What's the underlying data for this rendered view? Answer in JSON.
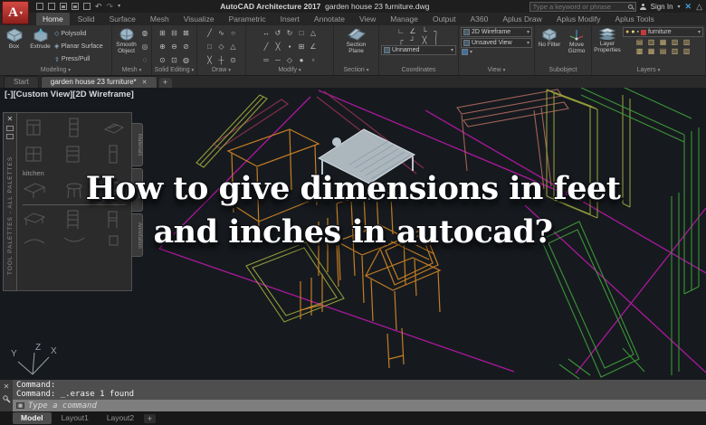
{
  "titlebar": {
    "app_title": "AutoCAD Architecture 2017",
    "doc_title": "garden house 23 furniture.dwg",
    "search_placeholder": "Type a keyword or phrase",
    "sign_in_label": "Sign In"
  },
  "ribbon": {
    "tabs": [
      {
        "label": "Home",
        "active": true
      },
      {
        "label": "Solid"
      },
      {
        "label": "Surface"
      },
      {
        "label": "Mesh"
      },
      {
        "label": "Visualize"
      },
      {
        "label": "Parametric"
      },
      {
        "label": "Insert"
      },
      {
        "label": "Annotate"
      },
      {
        "label": "View"
      },
      {
        "label": "Manage"
      },
      {
        "label": "Output"
      },
      {
        "label": "A360"
      },
      {
        "label": "Aplus Draw"
      },
      {
        "label": "Aplus Modify"
      },
      {
        "label": "Aplus Tools"
      }
    ],
    "panels": {
      "modeling": {
        "label": "Modeling",
        "box": "Box",
        "extrude": "Extrude",
        "polysolid": "Polysolid",
        "planar_surface": "Planar Surface",
        "press_pull": "Press/Pull"
      },
      "mesh": {
        "label": "Mesh",
        "smooth_object": "Smooth Object"
      },
      "solid_editing": {
        "label": "Solid Editing"
      },
      "draw": {
        "label": "Draw"
      },
      "modify": {
        "label": "Modify"
      },
      "section": {
        "label": "Section",
        "section_plane": "Section Plane"
      },
      "coordinates": {
        "label": "Coordinates",
        "named_ucs": "Unnamed"
      },
      "view": {
        "label": "View",
        "visual_style": "2D Wireframe",
        "named_view": "Unsaved View"
      },
      "subobject": {
        "label": "Subobject",
        "no_filter": "No Filter",
        "move_gizmo": "Move Gizmo"
      },
      "layers": {
        "label": "Layers",
        "layer_properties": "Layer Properties",
        "current_layer": "furniture"
      }
    },
    "icon_grids": {
      "mesh_col": [
        "◍",
        "◎",
        "◌"
      ],
      "solid_editing": [
        "⊞",
        "⊟",
        "⊠",
        "⊕",
        "⊖",
        "⊘",
        "⊙",
        "⊡",
        "◍"
      ],
      "draw": [
        "╱",
        "∿",
        "○",
        "□",
        "◇",
        "△",
        "╳",
        "┼",
        "⊙"
      ],
      "modify": [
        "↔",
        "↺",
        "↻",
        "□",
        "△",
        "╱",
        "╳",
        "▪",
        "⊞",
        "∠",
        "═",
        "─",
        "◇",
        "●",
        "▫"
      ],
      "coords_r1": [
        "∟",
        "∠",
        "└",
        "┐"
      ],
      "coords_r2": [
        "┌",
        "┘",
        "╳",
        "│"
      ],
      "layers_r1": [
        "▤",
        "▥",
        "▦",
        "▧",
        "▨"
      ],
      "layers_r2": [
        "▩",
        "▦",
        "▤",
        "▥",
        "▧"
      ]
    }
  },
  "file_tabs": {
    "start": "Start",
    "doc": "garden house 23 furniture*",
    "close": "✕",
    "new_tab": "+"
  },
  "viewport_label": "[-][Custom View][2D Wireframe]",
  "palette": {
    "title": "TOOL PALETTES - ALL PALETTES",
    "group": "kitchen",
    "tabs": [
      "Materials",
      "Details",
      "Annotation"
    ],
    "close": "✕"
  },
  "overlay": {
    "line1": "How to give dimensions in feet",
    "line2": "and inches in autocad?"
  },
  "ucs": {
    "x": "X",
    "y": "Y",
    "z": "Z"
  },
  "command": {
    "history_line1": "Command:",
    "history_line2": "Command: _.erase 1 found",
    "placeholder": "Type a command"
  },
  "layout_tabs": {
    "model": "Model",
    "layout1": "Layout1",
    "layout2": "Layout2",
    "new_tab": "+"
  },
  "colors": {
    "canvas_bg": "#161a1e",
    "wall_magenta": "#b417a5",
    "cabinet_green": "#3f9b3b",
    "frame_olive": "#9aa23c",
    "furniture_orange": "#cd8326",
    "accent_salmon": "#b06a5e",
    "desk_gray": "#b9c3cb",
    "layer_swatch_red": "#c23b3b",
    "exchange_blue": "#3f9fd8"
  }
}
